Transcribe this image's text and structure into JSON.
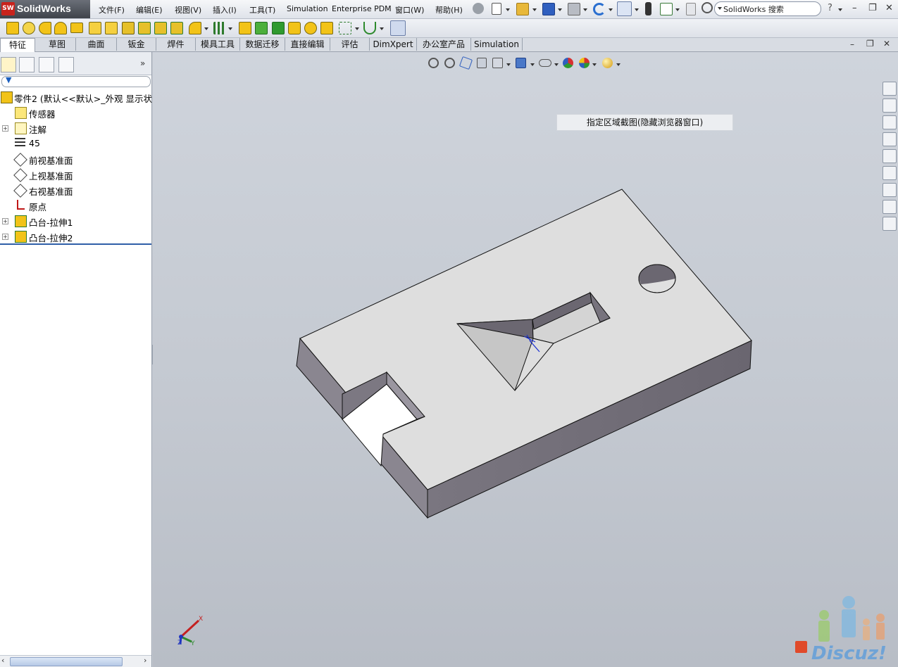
{
  "app": {
    "name": "SolidWorks",
    "logo_text": "SW"
  },
  "menu": {
    "items": [
      "文件(F)",
      "编辑(E)",
      "视图(V)",
      "插入(I)",
      "工具(T)",
      "Simulation",
      "Enterprise PDM",
      "窗口(W)",
      "帮助(H)"
    ],
    "search_placeholder": "SolidWorks 搜索",
    "help_label": "?"
  },
  "tabs": [
    "特征",
    "草图",
    "曲面",
    "钣金",
    "焊件",
    "模具工具",
    "数据迁移",
    "直接编辑",
    "评估",
    "DimXpert",
    "办公室产品",
    "Simulation"
  ],
  "active_tab": "特征",
  "feature_tree": {
    "root": "零件2 (默认<<默认>_外观 显示状",
    "items": [
      {
        "label": "传感器",
        "icon": "sensor-icon",
        "expandable": false
      },
      {
        "label": "注解",
        "icon": "annotation-icon",
        "expandable": true
      },
      {
        "label": "45",
        "icon": "material-icon",
        "expandable": false
      },
      {
        "label": "前视基准面",
        "icon": "plane-icon",
        "expandable": false
      },
      {
        "label": "上视基准面",
        "icon": "plane-icon",
        "expandable": false
      },
      {
        "label": "右视基准面",
        "icon": "plane-icon",
        "expandable": false
      },
      {
        "label": "原点",
        "icon": "origin-icon",
        "expandable": false
      },
      {
        "label": "凸台-拉伸1",
        "icon": "extrude-icon",
        "expandable": true
      },
      {
        "label": "凸台-拉伸2",
        "icon": "extrude-icon",
        "expandable": true
      }
    ]
  },
  "viewport": {
    "tooltip": "指定区域截图(隐藏浏览器窗口)",
    "triad": {
      "x_label": "X",
      "y_label": "Y",
      "z_label": "Z"
    }
  },
  "watermark": {
    "text": "Discuz!"
  },
  "colors": {
    "part_top": "#dedede",
    "part_side_dark": "#6e6a73",
    "part_side_mid": "#8a8690",
    "viewport_bg": "#c5cad3",
    "brand_red": "#c8231d"
  }
}
